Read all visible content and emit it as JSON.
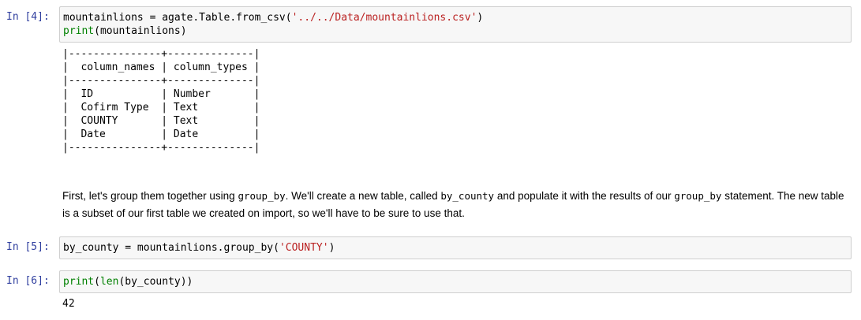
{
  "cells": [
    {
      "prompt": "In [4]:",
      "code_line1_a": "mountainlions = agate.Table.from_csv(",
      "code_line1_str": "'../../Data/mountainlions.csv'",
      "code_line1_b": ")",
      "code_line2_fn": "print",
      "code_line2_b": "(mountainlions)",
      "output_lines": [
        "|---------------+--------------|",
        "|  column_names | column_types |",
        "|---------------+--------------|",
        "|  ID           | Number       |",
        "|  Cofirm Type  | Text         |",
        "|  COUNTY       | Text         |",
        "|  Date         | Date         |",
        "|---------------+--------------|"
      ]
    },
    {
      "prompt": "In [5]:",
      "code_a": "by_county = mountainlions.group_by(",
      "code_str": "'COUNTY'",
      "code_b": ")"
    },
    {
      "prompt": "In [6]:",
      "code_fn1": "print",
      "code_mid1": "(",
      "code_fn2": "len",
      "code_b": "(by_county))",
      "output": "42"
    }
  ],
  "markdown": {
    "t1": "First, let's group them together using ",
    "c1": "group_by",
    "t2": ". We'll create a new table, called ",
    "c2": "by_county",
    "t3": " and populate it with the results of our ",
    "c3": "group_by",
    "t4": " statement. The new table is a subset of our first table we created on import, so we'll have to be sure to use that."
  }
}
